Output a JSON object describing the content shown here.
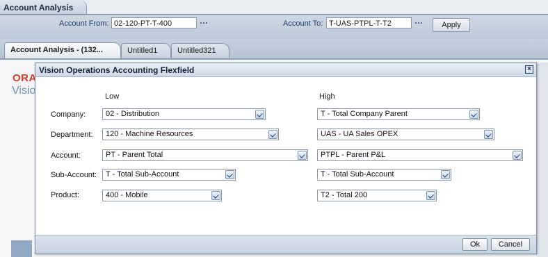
{
  "window": {
    "title": "Account Analysis"
  },
  "header": {
    "account_from_label": "Account From:",
    "account_from_value": "02-120-PT-T-400",
    "account_to_label": "Account To:",
    "account_to_value": "T-UAS-PTPL-T-T2",
    "dots": "…",
    "apply_label": "Apply"
  },
  "tabs": [
    {
      "label": "Account Analysis - (132...",
      "active": true
    },
    {
      "label": "Untitled1",
      "active": false
    },
    {
      "label": "Untitled321",
      "active": false
    }
  ],
  "background": {
    "logo_text": "ORA",
    "subtitle_text": "Visio"
  },
  "dialog": {
    "title": "Vision Operations Accounting Flexfield",
    "low_label": "Low",
    "high_label": "High",
    "rows": [
      {
        "label": "Company:",
        "low": "02 - Distribution",
        "high": "T - Total Company Parent"
      },
      {
        "label": "Department:",
        "low": "120 - Machine Resources",
        "high": "UAS - UA Sales OPEX"
      },
      {
        "label": "Account:",
        "low": "PT - Parent Total",
        "high": "PTPL - Parent P&L"
      },
      {
        "label": "Sub-Account:",
        "low": "T - Total Sub-Account",
        "high": "T - Total Sub-Account"
      },
      {
        "label": "Product:",
        "low": "400 - Mobile",
        "high": "T2 - Total 200"
      }
    ],
    "ok_label": "Ok",
    "cancel_label": "Cancel"
  }
}
